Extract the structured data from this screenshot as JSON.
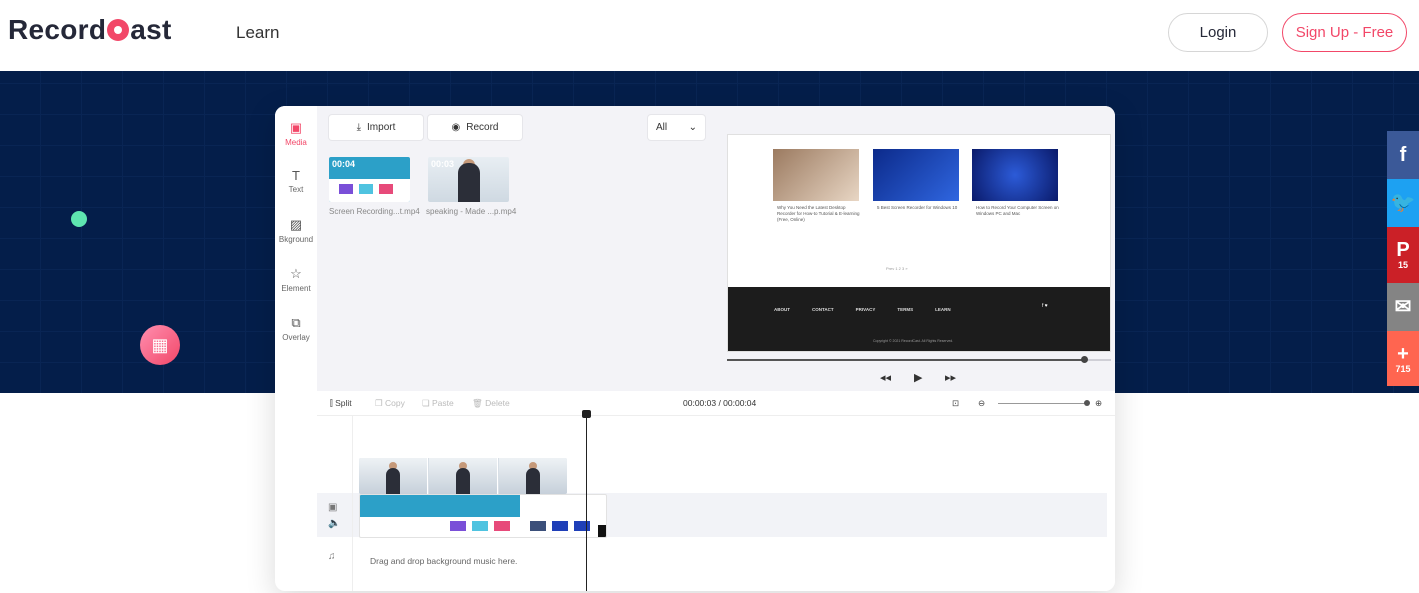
{
  "header": {
    "logo_text_before": "Record",
    "logo_text_after": "ast",
    "nav_learn": "Learn",
    "login_label": "Login",
    "signup_label": "Sign Up - Free"
  },
  "colors": {
    "brand": "#f24768",
    "hero_bg": "#041e4a",
    "facebook": "#3b5998",
    "twitter": "#1da1f2",
    "pinterest": "#cb2027",
    "email": "#848484",
    "share": "#ff6550"
  },
  "editor": {
    "rail": [
      {
        "label": "Media",
        "icon": "folder-icon",
        "glyph": "▣"
      },
      {
        "label": "Text",
        "icon": "text-icon",
        "glyph": "T"
      },
      {
        "label": "Bkground",
        "icon": "image-icon",
        "glyph": "▨"
      },
      {
        "label": "Element",
        "icon": "star-icon",
        "glyph": "☆"
      },
      {
        "label": "Overlay",
        "icon": "overlay-icon",
        "glyph": "⧉"
      }
    ],
    "import_label": "Import",
    "record_label": "Record",
    "filter_value": "All",
    "media_items": [
      {
        "name": "Screen Recording...t.mp4",
        "duration": "00:04"
      },
      {
        "name": "speaking - Made ...p.mp4",
        "duration": "00:03"
      }
    ],
    "preview": {
      "cards": [
        "Why You Need the Latest Desktop Recorder for How-to Tutorial & E-learning (Free, Online)",
        "5 Best Screen Recorder for Windows 10",
        "How to Record Your Computer Screen on Windows PC and Mac"
      ],
      "pager": "Prev  1   2   3   »",
      "footer_links": [
        "ABOUT",
        "CONTACT",
        "PRIVACY",
        "TERMS",
        "LEARN"
      ],
      "social": "f  ♥",
      "copyright": "Copyright © 2021 RecordCast. All Rights Reserved.",
      "progress": 0.93
    },
    "toolbar": {
      "split": "Split",
      "copy": "Copy",
      "paste": "Paste",
      "delete": "Delete",
      "time": "00:00:03 / 00:00:04"
    },
    "zoom_level": 1.0,
    "drag_text": "Drag and drop background music here."
  },
  "social": [
    {
      "name": "facebook",
      "glyph": "f",
      "count": ""
    },
    {
      "name": "twitter",
      "glyph": "🐦",
      "count": ""
    },
    {
      "name": "pinterest",
      "glyph": "P",
      "count": "15"
    },
    {
      "name": "email",
      "glyph": "✉",
      "count": ""
    },
    {
      "name": "share",
      "glyph": "+",
      "count": "715"
    }
  ]
}
